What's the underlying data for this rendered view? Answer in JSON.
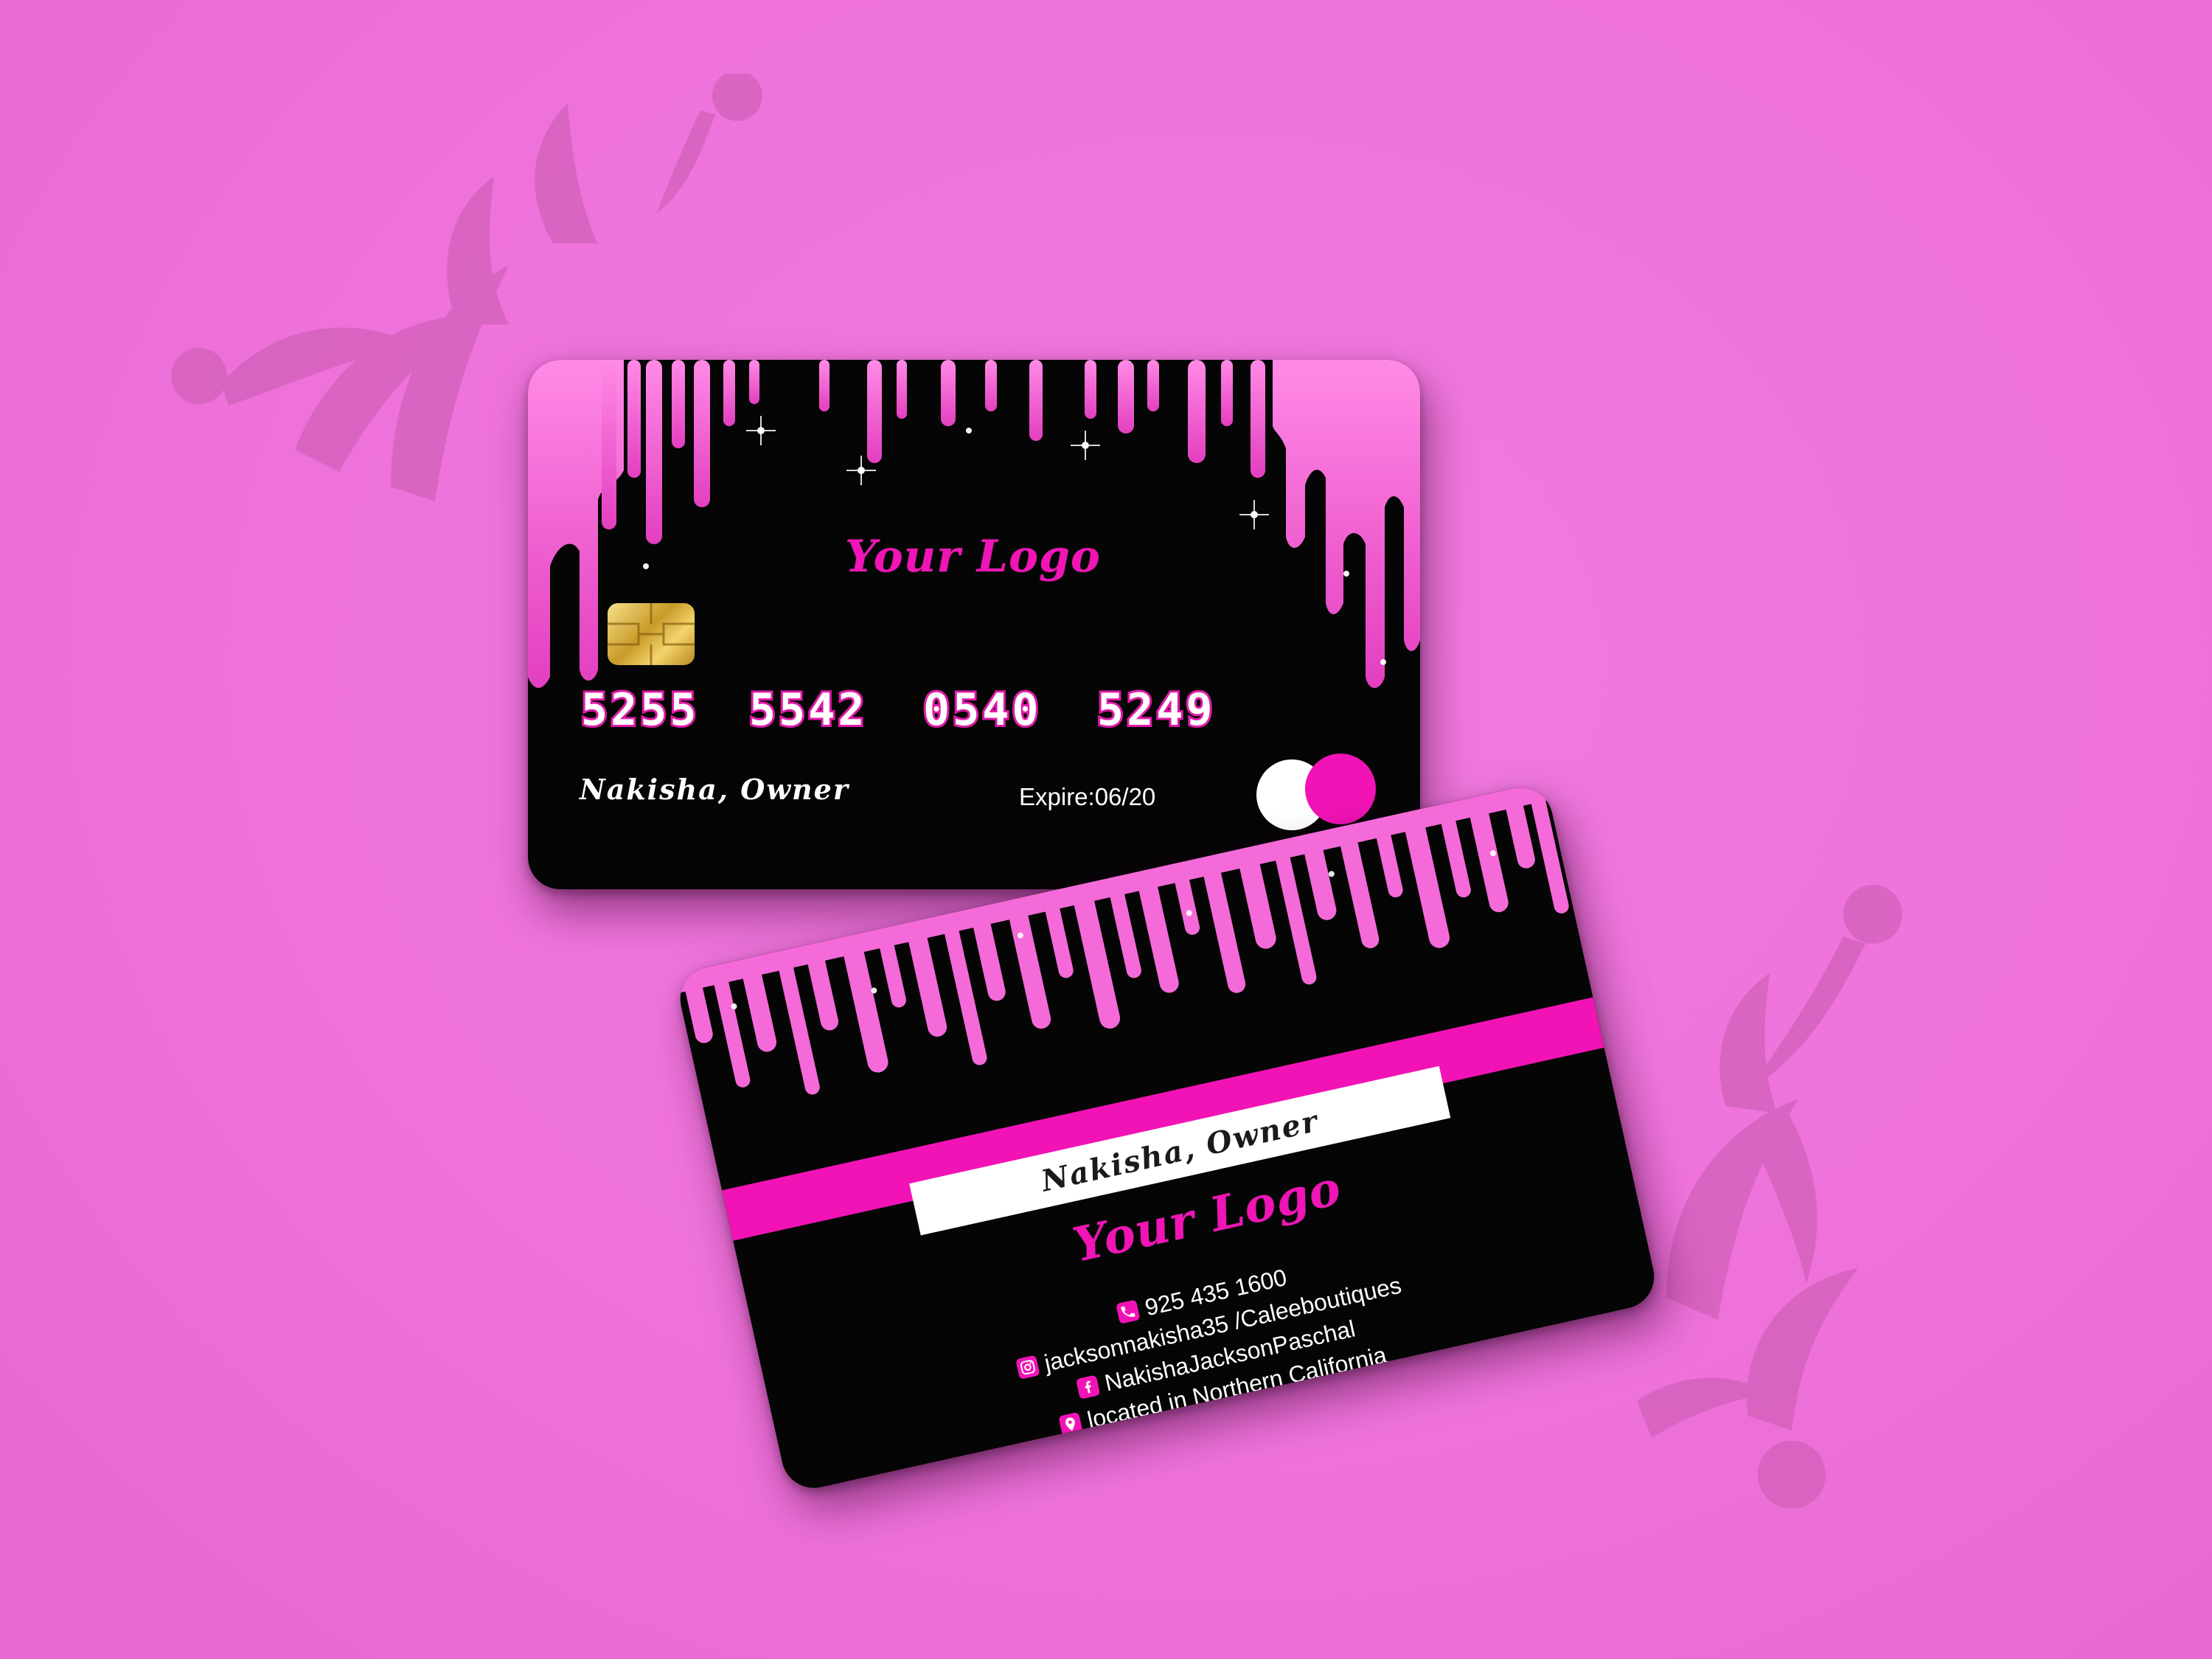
{
  "front": {
    "logo": "Your Logo",
    "card_number": [
      "5255",
      "5542",
      "0540",
      "5249"
    ],
    "holder": "Nakisha, Owner",
    "expire": "Expire:06/20"
  },
  "back": {
    "holder": "Nakisha, Owner",
    "logo": "Your Logo",
    "contacts": [
      {
        "icon": "phone-icon",
        "text": "925 435 1600"
      },
      {
        "icon": "instagram-icon",
        "text": "jacksonnakisha35 /Caleeboutiques"
      },
      {
        "icon": "facebook-icon",
        "text": "NakishaJacksonPaschal"
      },
      {
        "icon": "location-pin-icon",
        "text": "located in Northern California"
      }
    ]
  },
  "colors": {
    "background": "#ef74dc",
    "card": "#050505",
    "accent_pink": "#f213b6",
    "glitter_pink": "#f46ad8",
    "chip_gold": "#d8ad3c",
    "ornament": "#c85aae"
  }
}
